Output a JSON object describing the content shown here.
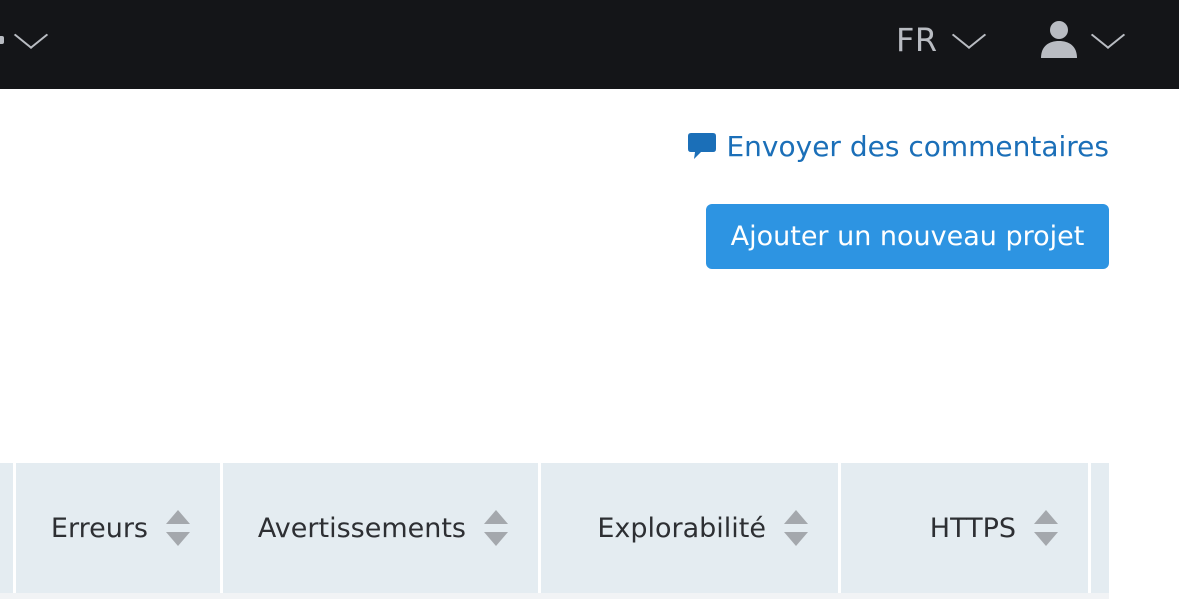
{
  "topbar": {
    "language": "FR",
    "icons": {
      "left_chevron": "chevron-down-icon",
      "language_chevron": "chevron-down-icon",
      "user": "user-icon",
      "user_chevron": "chevron-down-icon"
    },
    "colors": {
      "background": "#141518",
      "foreground": "#b9bcc2"
    }
  },
  "actions": {
    "feedback_label": "Envoyer des commentaires",
    "feedback_icon": "speech-bubble-icon",
    "add_project_label": "Ajouter un nouveau projet",
    "colors": {
      "link": "#1b6fb8",
      "primary_button": "#2d94e2"
    }
  },
  "table": {
    "columns": [
      {
        "label": "Erreurs",
        "sort_icon": "sort-icon"
      },
      {
        "label": "Avertissements",
        "sort_icon": "sort-icon"
      },
      {
        "label": "Explorabilité",
        "sort_icon": "sort-icon"
      },
      {
        "label": "HTTPS",
        "sort_icon": "sort-icon"
      }
    ],
    "colors": {
      "header_background": "#e4ecf1"
    }
  }
}
